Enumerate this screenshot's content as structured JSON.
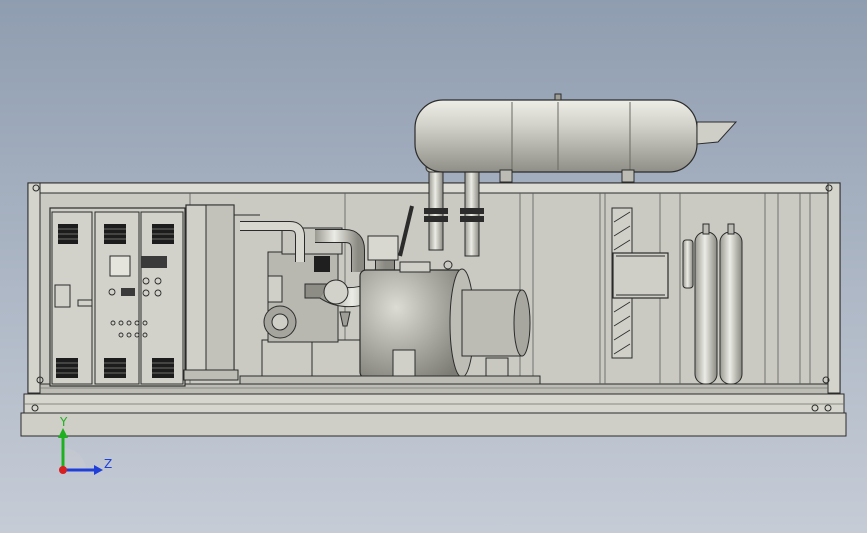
{
  "viewport": {
    "background_top": "#8f9db0",
    "background_bottom": "#c6ccd6"
  },
  "model": {
    "body_color": "#c9c9c1",
    "edge_color": "#2b2b2b",
    "shadow_color": "#8e8e86"
  },
  "triad": {
    "y_label": "Y",
    "z_label": "Z",
    "y_color": "#1fb01f",
    "z_color": "#1f3fd8",
    "origin_color": "#d81f1f"
  }
}
